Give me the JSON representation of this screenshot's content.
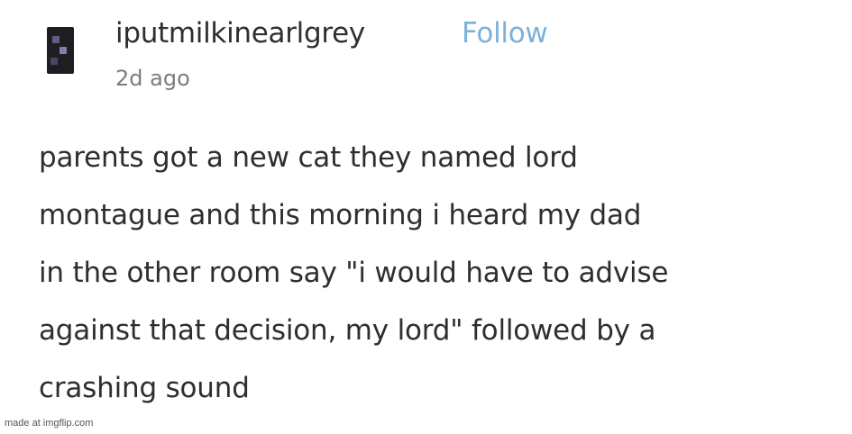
{
  "post": {
    "username": "iputmilkinearlgrey",
    "follow_label": "Follow",
    "timestamp": "2d ago",
    "lines": [
      "parents got a new cat they named lord",
      "montague and this morning i heard my dad",
      "in the other room say \"i would have to advise",
      "against that decision, my lord\" followed by a",
      "crashing sound"
    ]
  },
  "watermark": "made at imgflip.com",
  "colors": {
    "follow_link": "#7ab3d9",
    "text": "#2e2e2e",
    "timestamp": "#7c7c7c",
    "avatar_bg": "#1e1e22"
  }
}
